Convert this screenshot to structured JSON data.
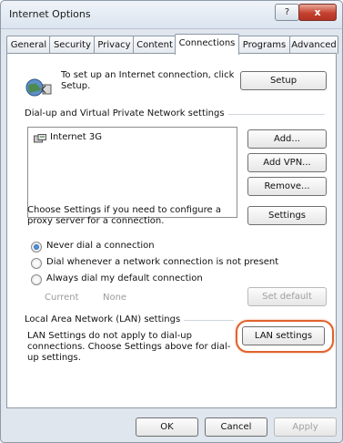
{
  "window": {
    "title": "Internet Options",
    "help_label": "?",
    "close_label": "x"
  },
  "tabs": [
    {
      "label": "General"
    },
    {
      "label": "Security"
    },
    {
      "label": "Privacy"
    },
    {
      "label": "Content"
    },
    {
      "label": "Connections",
      "active": true
    },
    {
      "label": "Programs"
    },
    {
      "label": "Advanced"
    }
  ],
  "setup": {
    "text": "To set up an Internet connection, click Setup.",
    "button": "Setup"
  },
  "dialup": {
    "label": "Dial-up and Virtual Private Network settings",
    "connections": [
      {
        "name": "Internet 3G"
      }
    ],
    "add_button": "Add...",
    "add_vpn_button": "Add VPN...",
    "remove_button": "Remove...",
    "proxy_text": "Choose Settings if you need to configure a proxy server for a connection.",
    "settings_button": "Settings",
    "options": [
      {
        "label": "Never dial a connection",
        "selected": true
      },
      {
        "label": "Dial whenever a network connection is not present",
        "selected": false
      },
      {
        "label": "Always dial my default connection",
        "selected": false
      }
    ],
    "current_label": "Current",
    "current_value": "None",
    "set_default_button": "Set default"
  },
  "lan": {
    "label": "Local Area Network (LAN) settings",
    "text": "LAN Settings do not apply to dial-up connections. Choose Settings above for dial-up settings.",
    "button": "LAN settings"
  },
  "footer": {
    "ok": "OK",
    "cancel": "Cancel",
    "apply": "Apply"
  },
  "colors": {
    "highlight": "#e0632e",
    "radio_selected": "#1b56a8"
  }
}
